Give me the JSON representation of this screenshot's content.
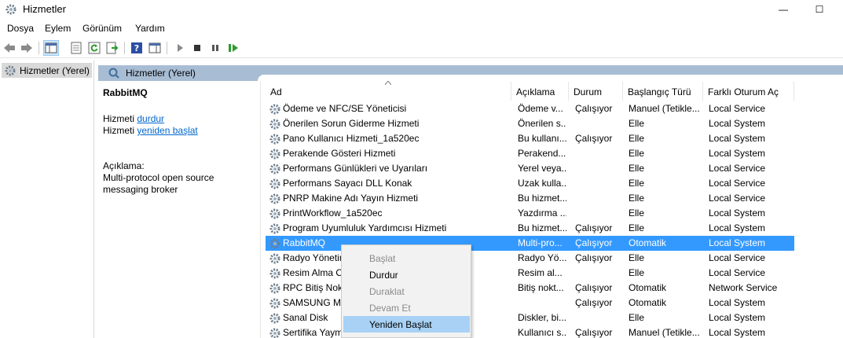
{
  "window": {
    "title": "Hizmetler",
    "min_glyph": "—",
    "max_glyph": "☐"
  },
  "menu": [
    "Dosya",
    "Eylem",
    "Görünüm",
    "Yardım"
  ],
  "toolbar_icons": [
    "back-icon",
    "forward-icon",
    "show-hide-tree-icon",
    "properties-icon",
    "refresh-icon",
    "export-icon",
    "help-icon",
    "show-hide-action-pane-icon",
    "start-service-icon",
    "stop-service-icon",
    "pause-service-icon",
    "restart-service-icon"
  ],
  "tree": {
    "root_label": "Hizmetler (Yerel)"
  },
  "header_band": {
    "label": "Hizmetler (Yerel)"
  },
  "details": {
    "service_name": "RabbitMQ",
    "stop_prefix": "Hizmeti",
    "stop_link": "durdur",
    "restart_prefix": "Hizmeti",
    "restart_link": "yeniden başlat",
    "desc_label": "Açıklama:",
    "desc_line1": "Multi-protocol open source",
    "desc_line2": "messaging broker"
  },
  "columns": [
    "Ad",
    "Açıklama",
    "Durum",
    "Başlangıç Türü",
    "Farklı Oturum Aç"
  ],
  "services": [
    {
      "name": "Ödeme ve NFC/SE Yöneticisi",
      "desc": "Ödeme v...",
      "state": "Çalışıyor",
      "start": "Manuel (Tetikle...",
      "logon": "Local Service"
    },
    {
      "name": "Önerilen Sorun Giderme Hizmeti",
      "desc": "Önerilen s...",
      "state": "",
      "start": "Elle",
      "logon": "Local System"
    },
    {
      "name": "Pano Kullanıcı Hizmeti_1a520ec",
      "desc": "Bu kullanı...",
      "state": "Çalışıyor",
      "start": "Elle",
      "logon": "Local System"
    },
    {
      "name": "Perakende Gösteri Hizmeti",
      "desc": "Perakend...",
      "state": "",
      "start": "Elle",
      "logon": "Local System"
    },
    {
      "name": "Performans Günlükleri ve Uyarıları",
      "desc": "Yerel veya...",
      "state": "",
      "start": "Elle",
      "logon": "Local Service"
    },
    {
      "name": "Performans Sayacı DLL Konak",
      "desc": "Uzak kulla...",
      "state": "",
      "start": "Elle",
      "logon": "Local Service"
    },
    {
      "name": "PNRP Makine Adı Yayın Hizmeti",
      "desc": "Bu hizmet...",
      "state": "",
      "start": "Elle",
      "logon": "Local Service"
    },
    {
      "name": "PrintWorkflow_1a520ec",
      "desc": "Yazdırma ...",
      "state": "",
      "start": "Elle",
      "logon": "Local System"
    },
    {
      "name": "Program Uyumluluk Yardımcısı Hizmeti",
      "desc": "Bu hizmet...",
      "state": "Çalışıyor",
      "start": "Elle",
      "logon": "Local System"
    },
    {
      "name": "RabbitMQ",
      "desc": "Multi-pro...",
      "state": "Çalışıyor",
      "start": "Otomatik",
      "logon": "Local System"
    },
    {
      "name": "Radyo Yönetim",
      "desc": "Radyo Yö...",
      "state": "Çalışıyor",
      "start": "Elle",
      "logon": "Local Service"
    },
    {
      "name": "Resim Alma O",
      "desc": "Resim al...",
      "state": "",
      "start": "Elle",
      "logon": "Local Service"
    },
    {
      "name": "RPC Bitiş Nokt",
      "desc": "Bitiş nokt...",
      "state": "Çalışıyor",
      "start": "Otomatik",
      "logon": "Network Service"
    },
    {
      "name": "SAMSUNG Mo",
      "desc": "",
      "state": "Çalışıyor",
      "start": "Otomatik",
      "logon": "Local System"
    },
    {
      "name": "Sanal Disk",
      "desc": "Diskler, bi...",
      "state": "",
      "start": "Elle",
      "logon": "Local System"
    },
    {
      "name": "Sertifika Yaym",
      "desc": "Kullanıcı s...",
      "state": "Çalışıyor",
      "start": "Manuel (Tetikle...",
      "logon": "Local System"
    }
  ],
  "selected_index": 9,
  "context_menu": [
    {
      "label": "Başlat",
      "enabled": false
    },
    {
      "label": "Durdur",
      "enabled": true
    },
    {
      "label": "Duraklat",
      "enabled": false
    },
    {
      "label": "Devam Et",
      "enabled": false
    },
    {
      "label": "Yeniden Başlat",
      "enabled": true,
      "highlighted": true
    }
  ],
  "colors": {
    "header_band": "#a8bdd4",
    "selection": "#3399ff",
    "menu_highlight": "#a8d1f5",
    "link": "#0066cc"
  }
}
